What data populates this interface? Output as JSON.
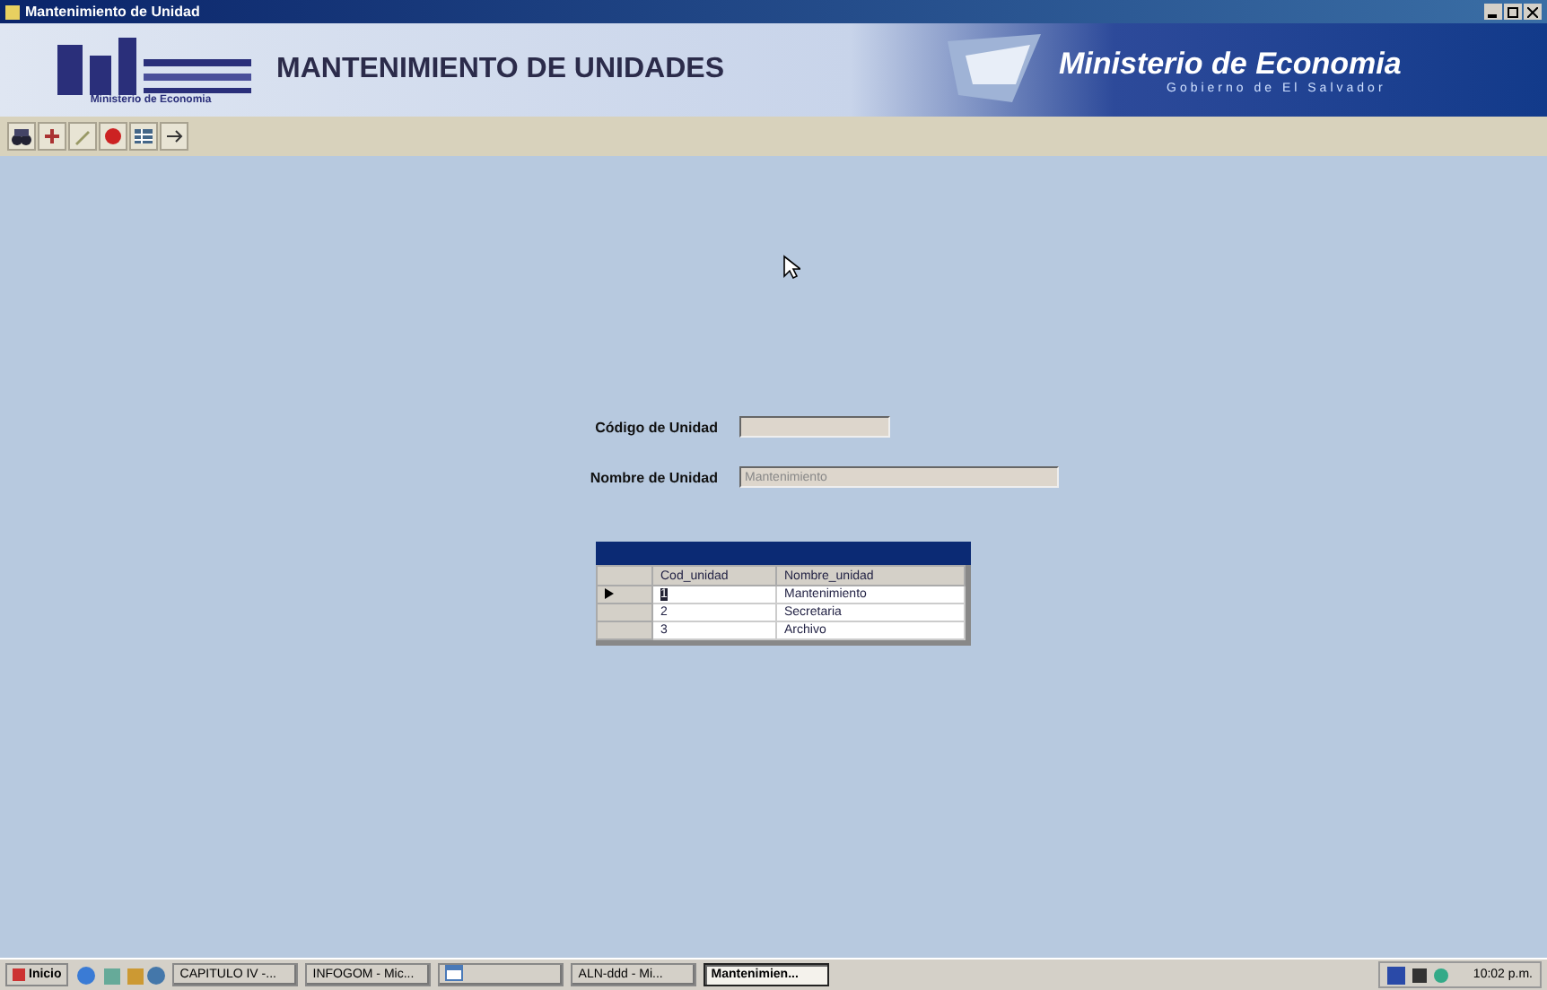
{
  "window": {
    "title": "Mantenimiento de Unidad"
  },
  "header": {
    "logo_caption": "Ministerio de Economia",
    "title": "MANTENIMIENTO DE UNIDADES",
    "ministry": "Ministerio de Economia",
    "government": "Gobierno de El Salvador"
  },
  "toolbar": {
    "buttons": [
      {
        "kind": "binoculars"
      },
      {
        "kind": "add"
      },
      {
        "kind": "edit"
      },
      {
        "kind": "delete"
      },
      {
        "kind": "grid"
      },
      {
        "kind": "exit"
      }
    ]
  },
  "form": {
    "fields": [
      {
        "label": "Código de Unidad",
        "wide": false
      },
      {
        "label": "Nombre de Unidad",
        "value": "Mantenimiento",
        "wide": true
      }
    ]
  },
  "grid": {
    "columns": [
      "Cod_unidad",
      "Nombre_unidad"
    ],
    "rows": [
      {
        "cells": [
          "1",
          "Mantenimiento"
        ],
        "selected": true
      },
      {
        "cells": [
          "2",
          "Secretaria"
        ],
        "selected": false
      },
      {
        "cells": [
          "3",
          "Archivo"
        ],
        "selected": false
      }
    ]
  },
  "taskbar": {
    "start": "Inicio",
    "tasks": [
      {
        "label": "CAPITULO IV -...",
        "selected": false
      },
      {
        "label": "INFOGOM - Mic...",
        "selected": false
      },
      {
        "kind": "icon",
        "selected": false
      },
      {
        "label": "ALN-ddd - Mi...",
        "selected": false
      },
      {
        "label": "Mantenimien...",
        "selected": true
      }
    ],
    "clock": "10:02 p.m."
  }
}
